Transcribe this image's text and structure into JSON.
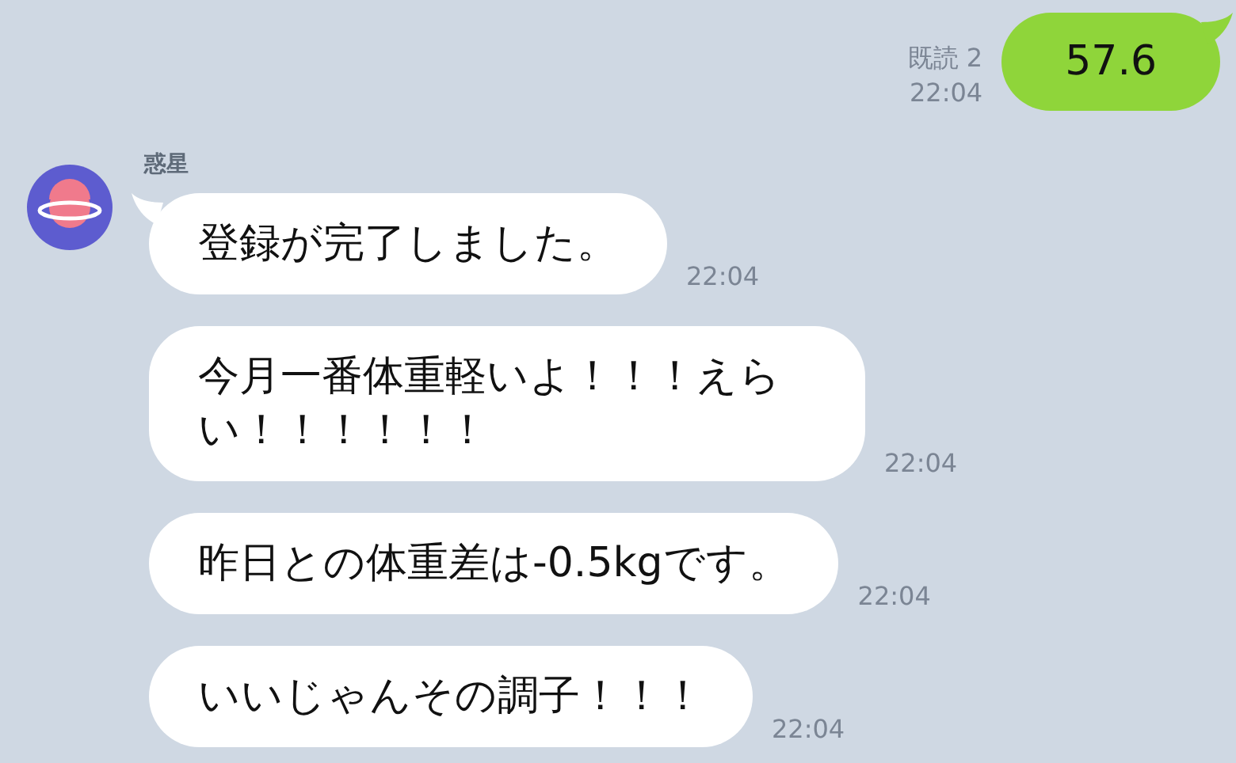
{
  "sent": [
    {
      "text": "57.6",
      "read_label": "既読 2",
      "time": "22:04"
    }
  ],
  "contact": {
    "name": "惑星"
  },
  "received": [
    {
      "text": "登録が完了しました。",
      "time": "22:04"
    },
    {
      "text": "今月一番体重軽いよ！！！えらい！！！！！！",
      "time": "22:04"
    },
    {
      "text": "昨日との体重差は-0.5kgです。",
      "time": "22:04"
    },
    {
      "text": "いいじゃんその調子！！！",
      "time": "22:04"
    }
  ]
}
